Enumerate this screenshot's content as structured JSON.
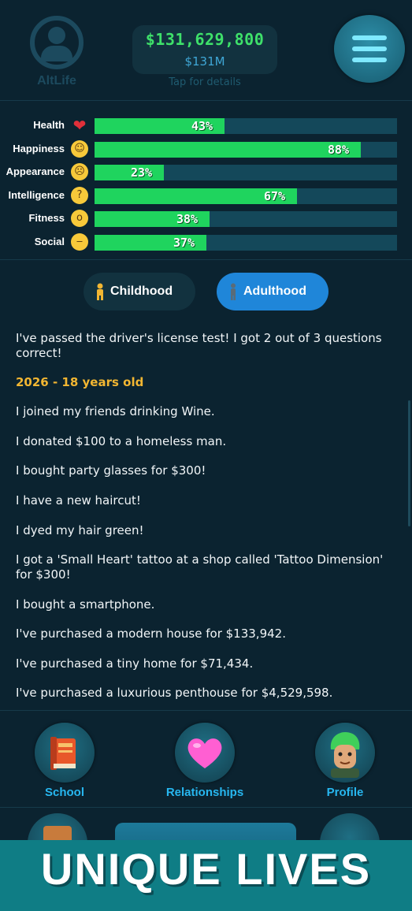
{
  "app": {
    "logo_text": "AltLife"
  },
  "header": {
    "money": "$131,629,800",
    "money_short": "$131M",
    "tap_hint": "Tap for details"
  },
  "stats": [
    {
      "label": "Health",
      "percent_text": "43%",
      "value": 43,
      "icon": "heart-icon"
    },
    {
      "label": "Happiness",
      "percent_text": "88%",
      "value": 88,
      "icon": "grinning-face-icon"
    },
    {
      "label": "Appearance",
      "percent_text": "23%",
      "value": 23,
      "icon": "fearful-face-icon"
    },
    {
      "label": "Intelligence",
      "percent_text": "67%",
      "value": 67,
      "icon": "thinking-face-icon"
    },
    {
      "label": "Fitness",
      "percent_text": "38%",
      "value": 38,
      "icon": "yawning-face-icon"
    },
    {
      "label": "Social",
      "percent_text": "37%",
      "value": 37,
      "icon": "neutral-face-icon"
    }
  ],
  "tabs": {
    "childhood": "Childhood",
    "adulthood": "Adulthood",
    "active": "adulthood"
  },
  "log": {
    "lines": [
      "I've passed the driver's license test! I got 2 out of 3 questions correct!",
      "2026 - 18 years old",
      "I joined my friends drinking Wine.",
      "I donated $100 to a homeless man.",
      "I bought party glasses for $300!",
      "I have a new haircut!",
      "I dyed my hair green!",
      "I got a 'Small Heart' tattoo at a shop called 'Tattoo Dimension' for $300!",
      "I bought a smartphone.",
      "I've purchased a modern house for $133,942.",
      "I've purchased a tiny home for $71,434.",
      "I've purchased a luxurious penthouse for $4,529,598."
    ]
  },
  "nav": {
    "school": "School",
    "relationships": "Relationships",
    "profile": "Profile"
  },
  "banner": {
    "text": "UNIQUE LIVES"
  },
  "colors": {
    "background": "#0b2330",
    "bar_fill": "#1fd45e",
    "bar_track": "#14485a",
    "accent_blue": "#1f86d9",
    "year_gold": "#f2b632",
    "nav_label": "#27b7f0"
  }
}
